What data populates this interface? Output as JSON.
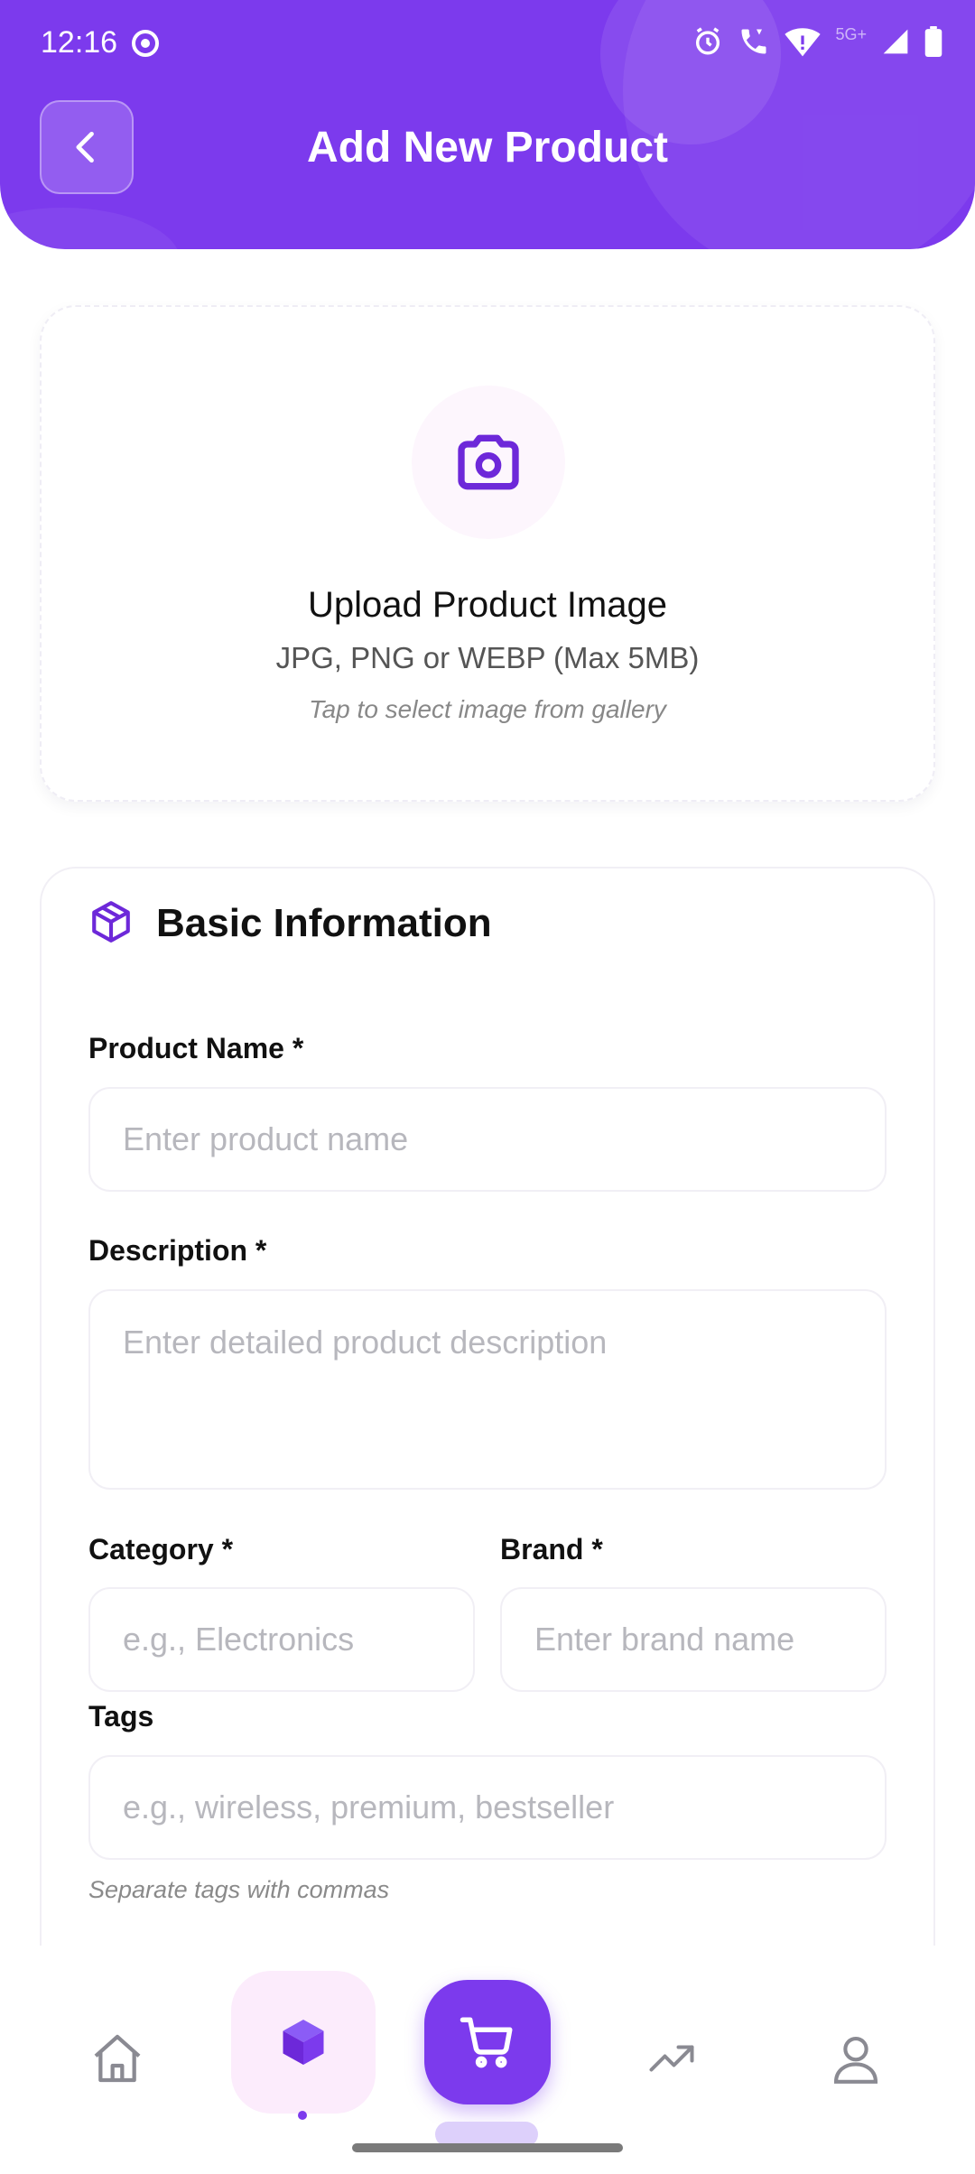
{
  "status_bar": {
    "time": "12:16",
    "network_label": "5G+"
  },
  "header": {
    "title": "Add New Product",
    "background_color": "#7c3aed"
  },
  "upload": {
    "title": "Upload Product Image",
    "formats": "JPG, PNG or WEBP (Max 5MB)",
    "hint": "Tap to select image from gallery",
    "icon": "camera-icon"
  },
  "basic_info": {
    "section_title": "Basic Information",
    "icon": "package-icon",
    "product_name": {
      "label": "Product Name *",
      "placeholder": "Enter product name"
    },
    "description": {
      "label": "Description *",
      "placeholder": "Enter detailed product description"
    },
    "category": {
      "label": "Category *",
      "placeholder": "e.g., Electronics"
    },
    "brand": {
      "label": "Brand *",
      "placeholder": "Enter brand name"
    },
    "tags": {
      "label": "Tags",
      "placeholder": "e.g., wireless, premium, bestseller",
      "note": "Separate tags with commas"
    }
  },
  "bottom_nav": {
    "items": [
      {
        "icon": "home-icon",
        "active": false
      },
      {
        "icon": "package-icon",
        "active": true
      },
      {
        "icon": "cart-icon",
        "active": false
      },
      {
        "icon": "trending-icon",
        "active": false
      },
      {
        "icon": "user-icon",
        "active": false
      }
    ],
    "accent_color": "#7c3aed"
  }
}
